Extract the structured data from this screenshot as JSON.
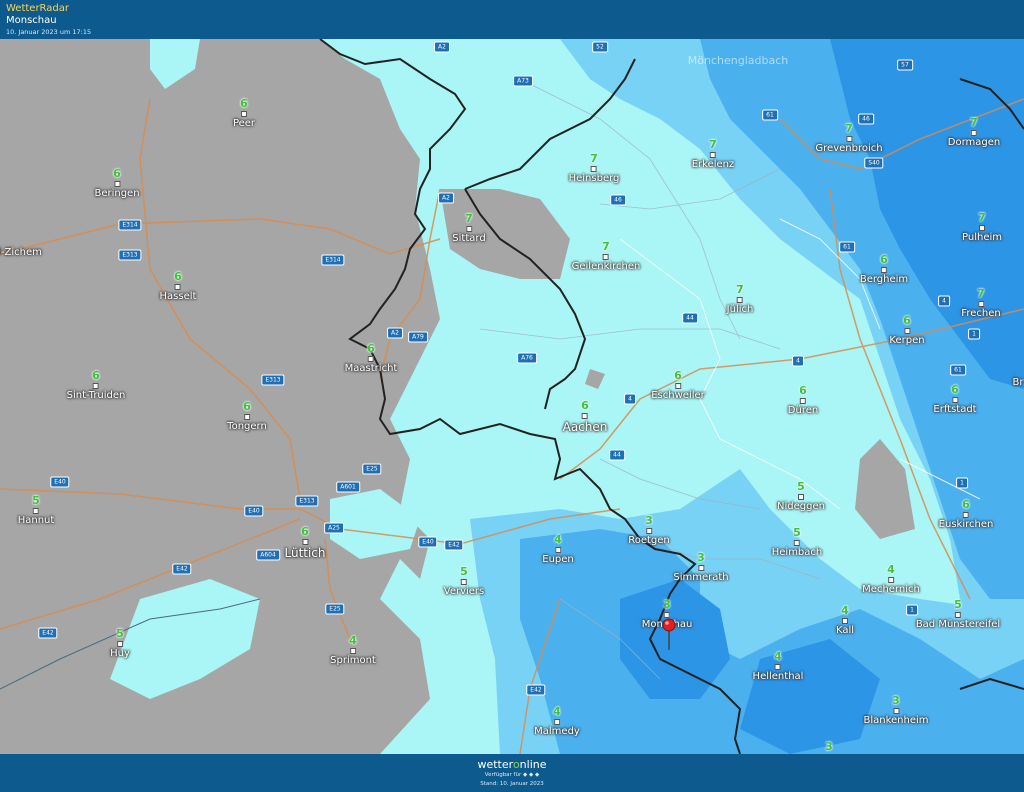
{
  "header": {
    "app_title": "WetterRadar",
    "location": "Monschau",
    "timestamp": "10. Januar 2023 um 17:15"
  },
  "map": {
    "colors": {
      "no_data": "#a6a6a6",
      "light": "#aaf5f5",
      "medium": "#78d2f5",
      "strong": "#4bb0ee",
      "heavy": "#2d95e6",
      "border": "#222222",
      "highway": "#d98b4e"
    },
    "faded_label": "Mönchengladbach",
    "cities": [
      {
        "name": "Peer",
        "temp": "6"
      },
      {
        "name": "Beringen",
        "temp": "6"
      },
      {
        "name": "l-Zichem",
        "temp": ""
      },
      {
        "name": "Hasselt",
        "temp": "6"
      },
      {
        "name": "Sint-Truiden",
        "temp": "6"
      },
      {
        "name": "Tongern",
        "temp": "6"
      },
      {
        "name": "Hannut",
        "temp": "5"
      },
      {
        "name": "Lüttich",
        "temp": "6"
      },
      {
        "name": "Huy",
        "temp": "5"
      },
      {
        "name": "Sprimont",
        "temp": "4"
      },
      {
        "name": "Verviers",
        "temp": "5"
      },
      {
        "name": "Maastricht",
        "temp": "6"
      },
      {
        "name": "Sittard",
        "temp": "7"
      },
      {
        "name": "Heinsberg",
        "temp": "7"
      },
      {
        "name": "Erkelenz",
        "temp": "7"
      },
      {
        "name": "Geilenkirchen",
        "temp": "7"
      },
      {
        "name": "Jülich",
        "temp": "7"
      },
      {
        "name": "Eschweiler",
        "temp": "6"
      },
      {
        "name": "Aachen",
        "temp": "6"
      },
      {
        "name": "Düren",
        "temp": "6"
      },
      {
        "name": "Eupen",
        "temp": "4"
      },
      {
        "name": "Roetgen",
        "temp": "3"
      },
      {
        "name": "Simmerath",
        "temp": "3"
      },
      {
        "name": "Monschau",
        "temp": "3"
      },
      {
        "name": "Nideggen",
        "temp": "5"
      },
      {
        "name": "Heimbach",
        "temp": "5"
      },
      {
        "name": "Hellenthal",
        "temp": "4"
      },
      {
        "name": "Malmedy",
        "temp": "4"
      },
      {
        "name": "Grevenbroich",
        "temp": "7"
      },
      {
        "name": "Dormagen",
        "temp": "7"
      },
      {
        "name": "Pulheim",
        "temp": "7"
      },
      {
        "name": "Bergheim",
        "temp": "6"
      },
      {
        "name": "Frechen",
        "temp": "7"
      },
      {
        "name": "Kerpen",
        "temp": "6"
      },
      {
        "name": "Erftstadt",
        "temp": "6"
      },
      {
        "name": "Euskirchen",
        "temp": "6"
      },
      {
        "name": "Mechernich",
        "temp": "4"
      },
      {
        "name": "Kall",
        "temp": "4"
      },
      {
        "name": "Bad Münstereifel",
        "temp": "5"
      },
      {
        "name": "Blankenheim",
        "temp": "3"
      },
      {
        "name": "",
        "temp": "3"
      },
      {
        "name": "Br",
        "temp": ""
      }
    ],
    "road_labels": [
      "A2",
      "A73",
      "52",
      "57",
      "61",
      "46",
      "S40",
      "A2",
      "46",
      "E314",
      "E313",
      "E314",
      "A2",
      "A79",
      "A76",
      "44",
      "4",
      "61",
      "4",
      "1",
      "61",
      "E313",
      "4",
      "1",
      "E25",
      "A601",
      "E40",
      "E313",
      "A25",
      "E40",
      "A604",
      "E40",
      "E42",
      "E42",
      "E25",
      "E42",
      "E42",
      "44",
      "1"
    ]
  },
  "footer": {
    "brand_pre": "wetter",
    "brand_o": "o",
    "brand_post": "nline",
    "available": "Verfügbar für  ◆ ◆ ◆",
    "stand": "Stand: 10. Januar 2023"
  }
}
